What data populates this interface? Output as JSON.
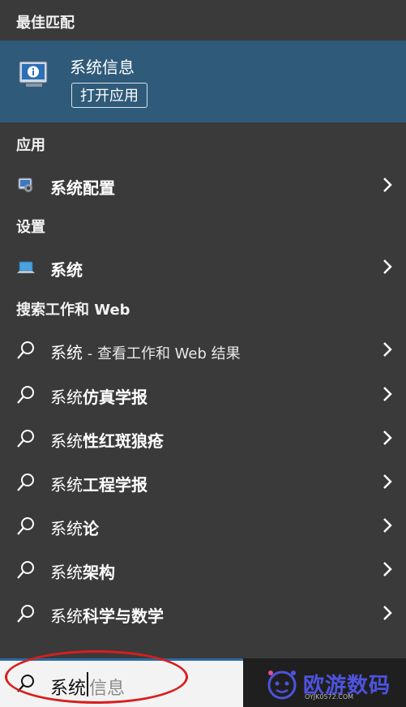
{
  "best_match": {
    "header": "最佳匹配",
    "title": "系统信息",
    "open_button": "打开应用"
  },
  "apps": {
    "header": "应用",
    "items": [
      {
        "label": "系统配置",
        "icon": "system-config-icon"
      }
    ]
  },
  "settings": {
    "header": "设置",
    "items": [
      {
        "label": "系统",
        "icon": "laptop-settings-icon"
      }
    ]
  },
  "web": {
    "header": "搜索工作和 Web",
    "first": {
      "em": "系统",
      "sub": " - 查看工作和 Web 结果"
    },
    "items": [
      {
        "prefix": "系统",
        "em": "仿真学报"
      },
      {
        "prefix": "系统",
        "em": "性红斑狼疮"
      },
      {
        "prefix": "系统",
        "em": "工程学报"
      },
      {
        "prefix": "系统",
        "em": "论"
      },
      {
        "prefix": "系统",
        "em": "架构"
      },
      {
        "prefix": "系统",
        "em": "科学与数学"
      }
    ]
  },
  "search": {
    "typed": "系统",
    "placeholder": "信息"
  },
  "watermark": {
    "name": "欧游数码",
    "url": "OYJK0572.COM"
  },
  "colors": {
    "panel_bg": "#3a3a3a",
    "selected_bg": "#2f5a79",
    "highlight_oval": "#d81e1e",
    "watermark": "#4e53e0"
  }
}
